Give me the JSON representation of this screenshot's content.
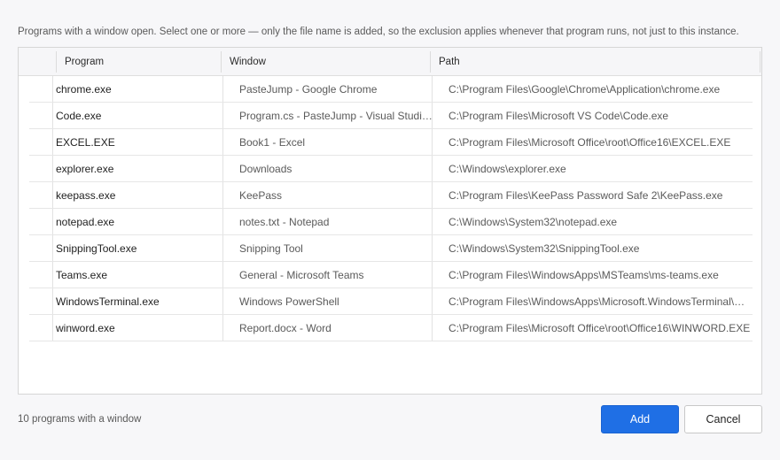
{
  "description": "Programs with a window open. Select one or more — only the file name is added, so the exclusion applies whenever that program runs, not just to this instance.",
  "table": {
    "columns": [
      "Program",
      "Window",
      "Path"
    ],
    "rows": [
      {
        "program": "chrome.exe",
        "window": "PasteJump - Google Chrome",
        "path": "C:\\Program Files\\Google\\Chrome\\Application\\chrome.exe"
      },
      {
        "program": "Code.exe",
        "window": "Program.cs - PasteJump - Visual Studio Code",
        "path": "C:\\Program Files\\Microsoft VS Code\\Code.exe"
      },
      {
        "program": "EXCEL.EXE",
        "window": "Book1 - Excel",
        "path": "C:\\Program Files\\Microsoft Office\\root\\Office16\\EXCEL.EXE"
      },
      {
        "program": "explorer.exe",
        "window": "Downloads",
        "path": "C:\\Windows\\explorer.exe"
      },
      {
        "program": "keepass.exe",
        "window": "KeePass",
        "path": "C:\\Program Files\\KeePass Password Safe 2\\KeePass.exe"
      },
      {
        "program": "notepad.exe",
        "window": "notes.txt - Notepad",
        "path": "C:\\Windows\\System32\\notepad.exe"
      },
      {
        "program": "SnippingTool.exe",
        "window": "Snipping Tool",
        "path": "C:\\Windows\\System32\\SnippingTool.exe"
      },
      {
        "program": "Teams.exe",
        "window": "General - Microsoft Teams",
        "path": "C:\\Program Files\\WindowsApps\\MSTeams\\ms-teams.exe"
      },
      {
        "program": "WindowsTerminal.exe",
        "window": "Windows PowerShell",
        "path": "C:\\Program Files\\WindowsApps\\Microsoft.WindowsTerminal\\WindowsTerminal.exe"
      },
      {
        "program": "winword.exe",
        "window": "Report.docx - Word",
        "path": "C:\\Program Files\\Microsoft Office\\root\\Office16\\WINWORD.EXE"
      }
    ]
  },
  "status": "10 programs with a window",
  "buttons": {
    "add": "Add",
    "cancel": "Cancel"
  },
  "colors": {
    "accent": "#1f6fe5",
    "background": "#f7f7f9"
  }
}
